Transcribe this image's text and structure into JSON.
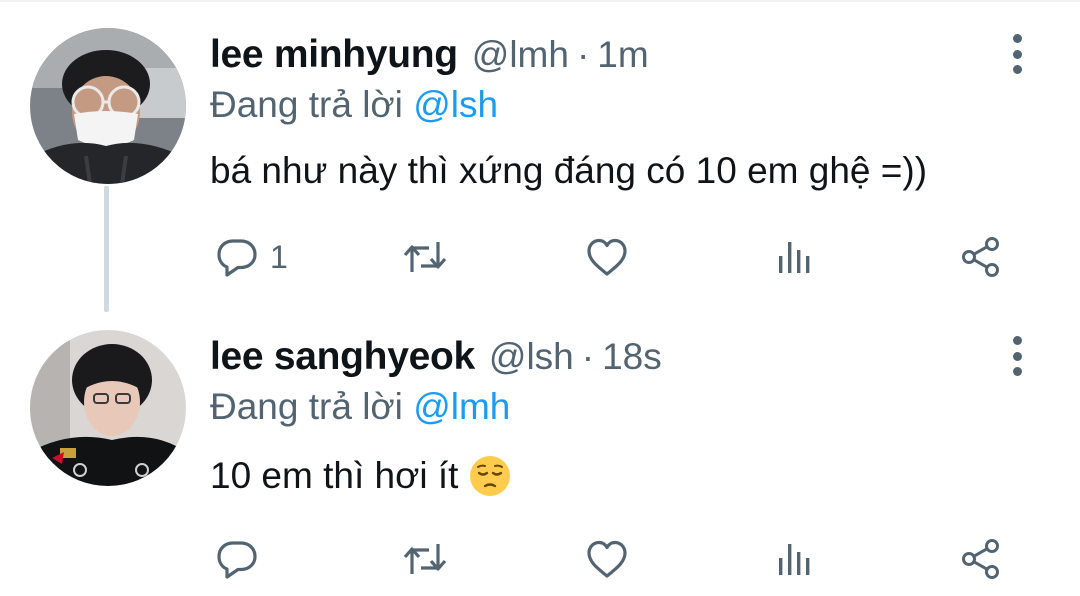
{
  "tweets": [
    {
      "display_name": "lee minhyung",
      "handle": "@lmh",
      "separator": "·",
      "time": "1m",
      "reply_prefix": "Đang trả lời",
      "reply_to": "@lsh",
      "text": "bá như này thì xứng đáng có 10 em ghệ =))",
      "reply_count": "1",
      "icons": [
        "comment-icon",
        "retweet-icon",
        "heart-icon",
        "analytics-icon",
        "share-icon",
        "more-icon"
      ]
    },
    {
      "display_name": "lee sanghyeok",
      "handle": "@lsh",
      "separator": "·",
      "time": "18s",
      "reply_prefix": "Đang trả lời",
      "reply_to": "@lmh",
      "text": "10 em thì hơi ít",
      "emoji": "pensive-face",
      "reply_count": "",
      "icons": [
        "comment-icon",
        "retweet-icon",
        "heart-icon",
        "analytics-icon",
        "share-icon",
        "more-icon"
      ]
    }
  ],
  "colors": {
    "text": "#0f1419",
    "secondary": "#536471",
    "accent": "#1d9bf0",
    "thread_line": "#cfd9de"
  }
}
